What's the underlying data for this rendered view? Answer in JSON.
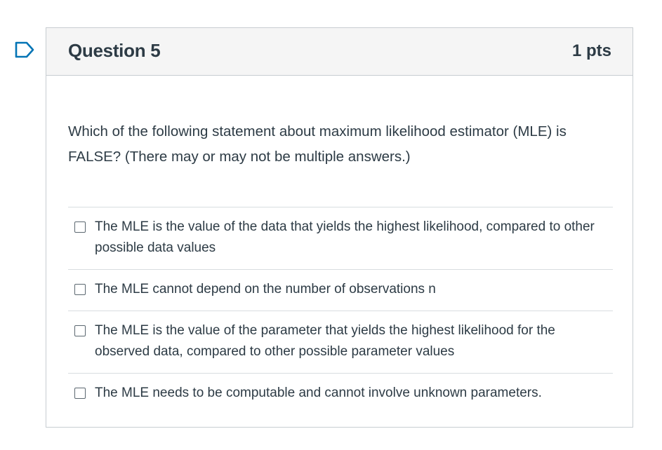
{
  "question": {
    "title": "Question 5",
    "points": "1 pts",
    "text": "Which of the following statement about maximum likelihood estimator (MLE) is FALSE? (There may or may not be multiple answers.)"
  },
  "answers": [
    {
      "label": "The MLE is the value of the data that yields the highest likelihood, compared to other possible data values",
      "checked": false
    },
    {
      "label": "The MLE cannot depend on the number of observations n",
      "checked": false
    },
    {
      "label": "The MLE is the value of the parameter that yields the highest likelihood for the observed data, compared to other possible parameter values",
      "checked": false
    },
    {
      "label": "The MLE needs to be computable and cannot involve unknown parameters.",
      "checked": false
    }
  ],
  "colors": {
    "accent": "#0374b5",
    "text": "#2d3b45",
    "header_bg": "#f5f5f5",
    "border": "#c7cdd1"
  },
  "icons": {
    "flag": "flag-question-icon"
  }
}
